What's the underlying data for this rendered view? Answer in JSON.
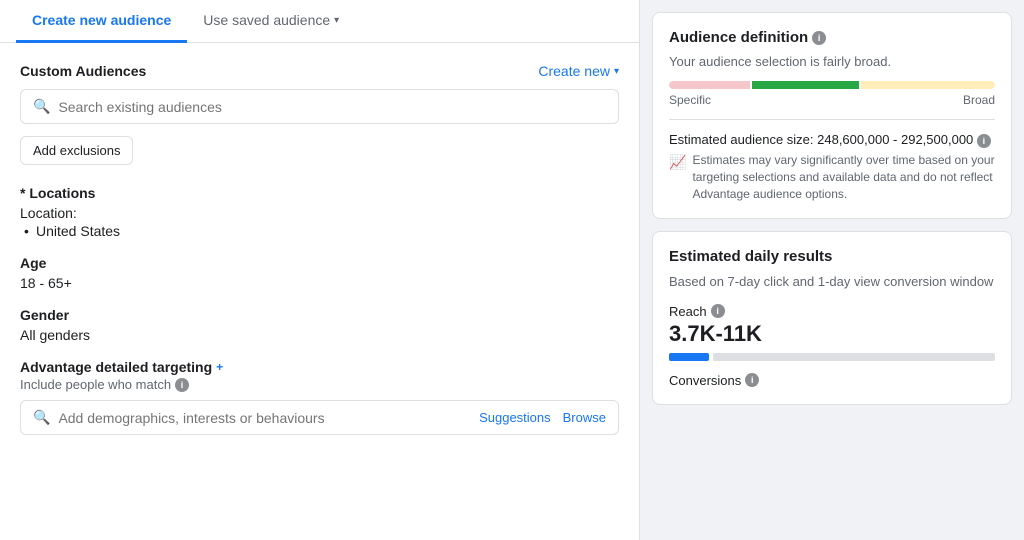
{
  "tabs": {
    "active": "Create new audience",
    "inactive": "Use saved audience"
  },
  "custom_audiences": {
    "section_title": "Custom Audiences",
    "create_new_label": "Create new",
    "search_placeholder": "Search existing audiences",
    "add_exclusions_label": "Add exclusions"
  },
  "locations": {
    "section_title": "* Locations",
    "location_label": "Location:",
    "location_value": "United States"
  },
  "age": {
    "section_title": "Age",
    "value": "18 - 65+"
  },
  "gender": {
    "section_title": "Gender",
    "value": "All genders"
  },
  "advantage": {
    "section_title": "Advantage detailed targeting",
    "plus_icon": "+",
    "include_label": "Include people who match",
    "search_placeholder": "Add demographics, interests or behaviours",
    "suggestions_label": "Suggestions",
    "browse_label": "Browse"
  },
  "audience_definition": {
    "card_title": "Audience definition",
    "description": "Your audience selection is fairly broad.",
    "gauge_specific_label": "Specific",
    "gauge_broad_label": "Broad",
    "estimated_size_label": "Estimated audience size: 248,600,000 - 292,500,000",
    "estimate_note": "Estimates may vary significantly over time based on your targeting selections and available data and do not reflect Advantage audience options."
  },
  "estimated_daily": {
    "card_title": "Estimated daily results",
    "description": "Based on 7-day click and 1-day view conversion window",
    "reach_label": "Reach",
    "reach_value": "3.7K-11K",
    "conversions_label": "Conversions"
  }
}
